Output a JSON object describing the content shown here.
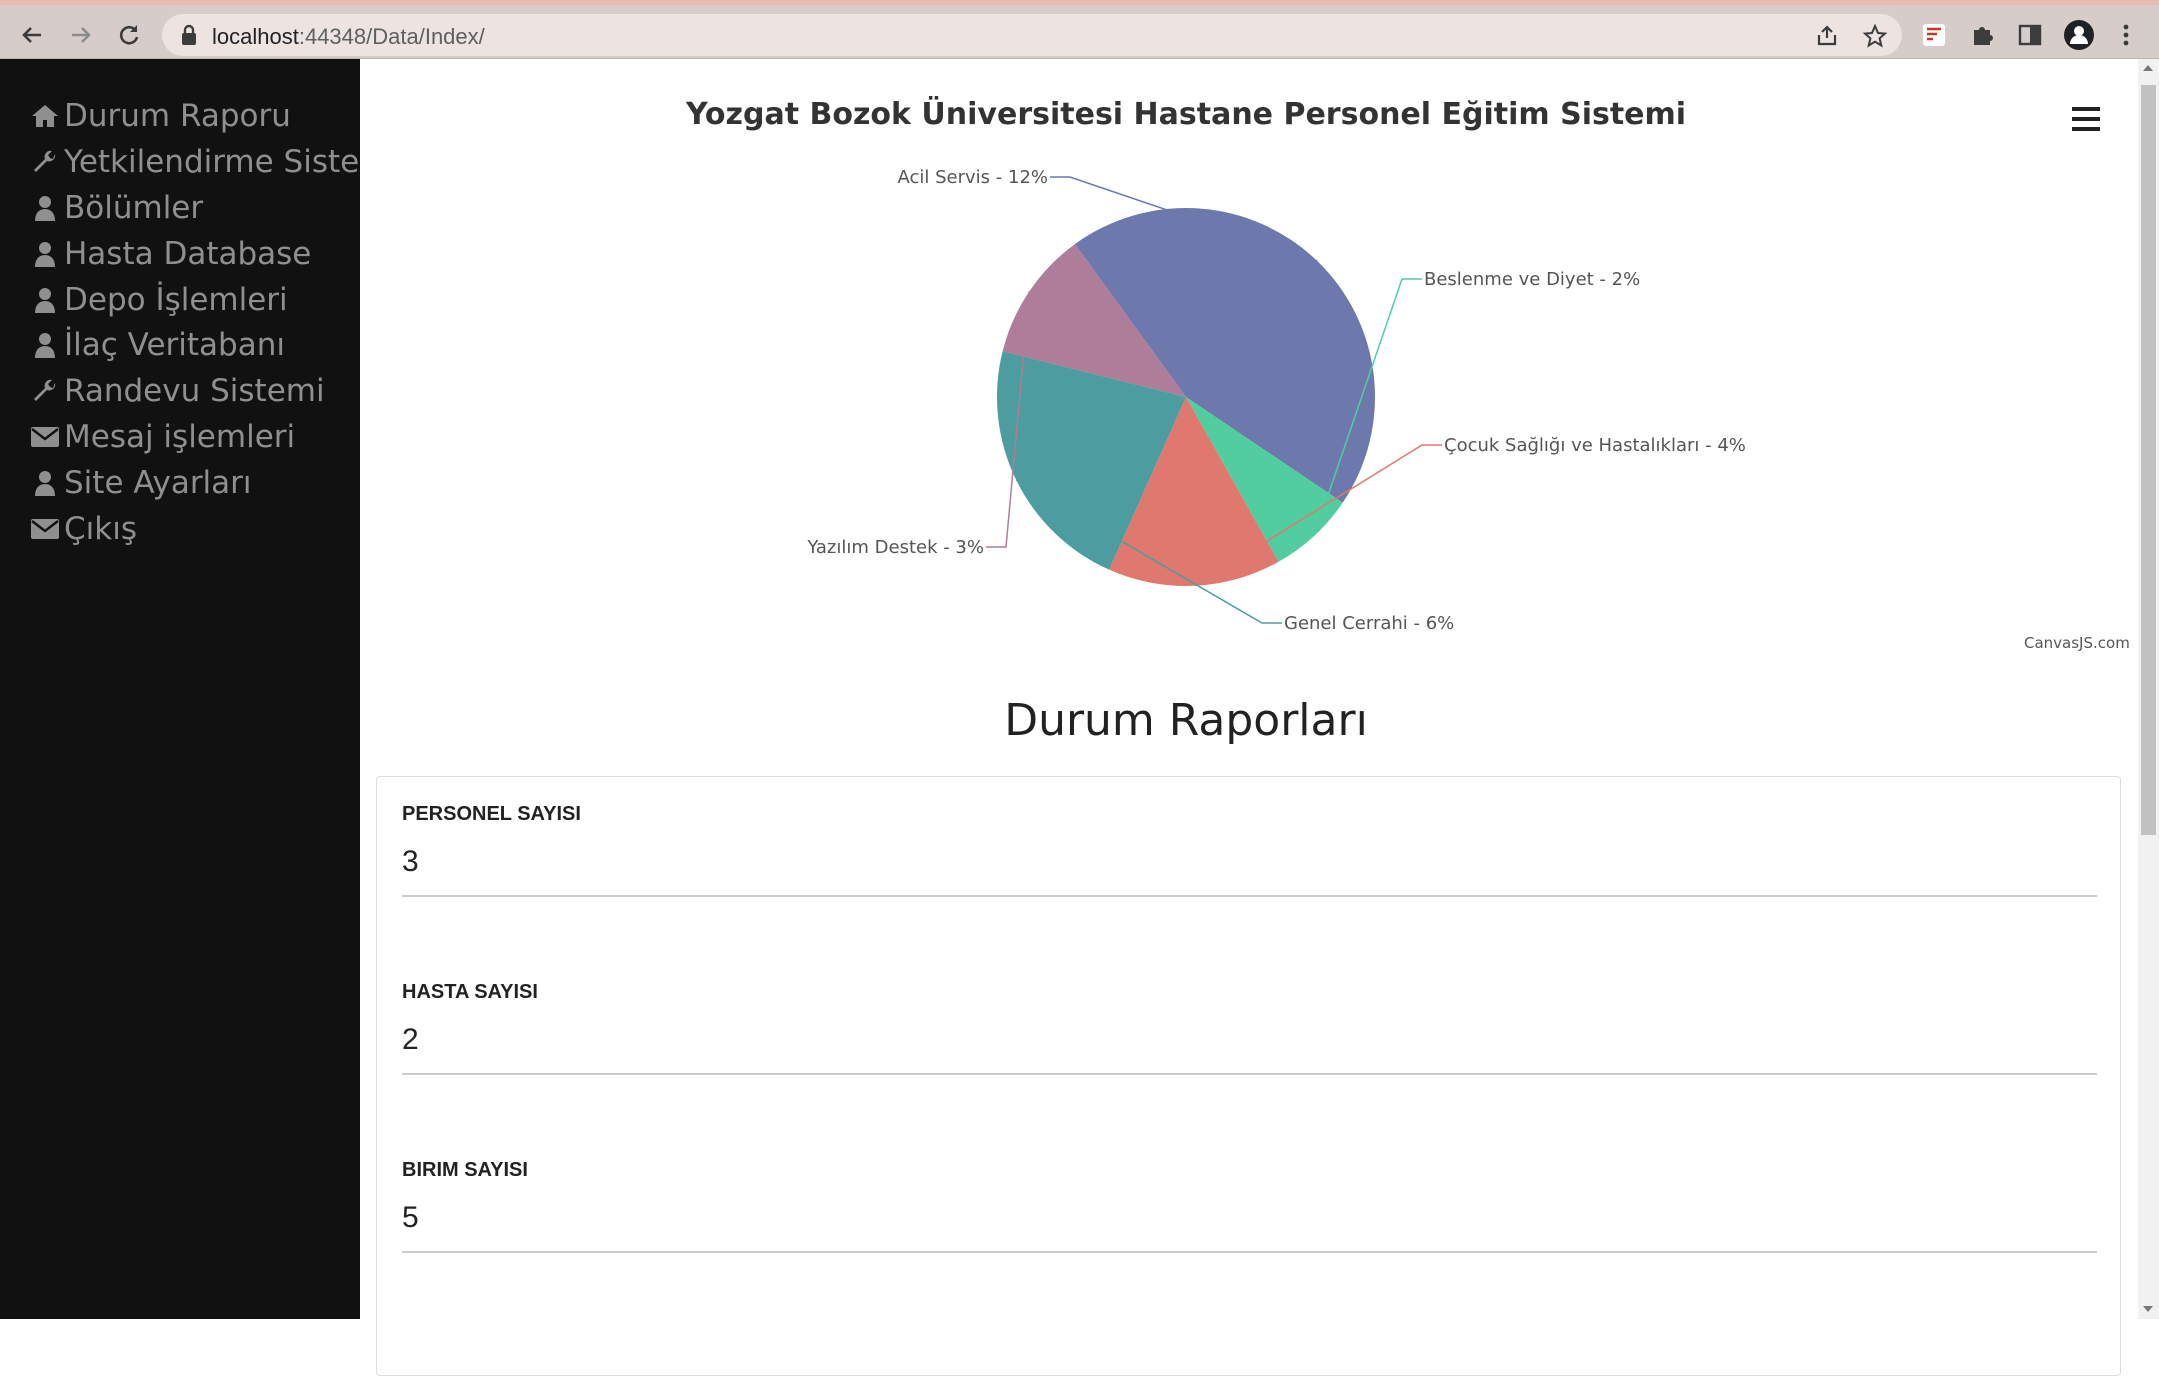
{
  "browser": {
    "url_host": "localhost",
    "url_rest": ":44348/Data/Index/"
  },
  "sidebar": {
    "items": [
      {
        "label": "Durum Raporu",
        "icon": "home-icon"
      },
      {
        "label": "Yetkilendirme Sistemi",
        "icon": "wrench-icon"
      },
      {
        "label": "Bölümler",
        "icon": "user-icon"
      },
      {
        "label": "Hasta Database",
        "icon": "user-icon"
      },
      {
        "label": "Depo İşlemleri",
        "icon": "user-icon"
      },
      {
        "label": "İlaç Veritabanı",
        "icon": "user-icon"
      },
      {
        "label": "Randevu Sistemi",
        "icon": "wrench-icon"
      },
      {
        "label": "Mesaj işlemleri",
        "icon": "envelope-icon"
      },
      {
        "label": "Site Ayarları",
        "icon": "user-icon"
      },
      {
        "label": "Çıkış",
        "icon": "envelope-icon"
      }
    ]
  },
  "chart_data": {
    "type": "pie",
    "title": "Yozgat Bozok Üniversitesi Hastane Personel Eğitim Sistemi",
    "slices": [
      {
        "name": "Acil Servis",
        "value": 12,
        "label": "Acil Servis - 12%",
        "color": "#6d78ad"
      },
      {
        "name": "Beslenme ve Diyet",
        "value": 2,
        "label": "Beslenme ve Diyet - 2%",
        "color": "#51cda0"
      },
      {
        "name": "Çocuk Sağlığı ve Hastalıkları",
        "value": 4,
        "label": "Çocuk Sağlığı ve Hastalıkları - 4%",
        "color": "#df7970"
      },
      {
        "name": "Genel Cerrahi",
        "value": 6,
        "label": "Genel Cerrahi - 6%",
        "color": "#4c9ca0"
      },
      {
        "name": "Yazılım Destek",
        "value": 3,
        "label": "Yazılım Destek - 3%",
        "color": "#ae7d99"
      }
    ],
    "credit": "CanvasJS.com"
  },
  "main": {
    "section_title": "Durum Raporları",
    "stats": [
      {
        "label": "PERSONEL SAYISI",
        "value": "3"
      },
      {
        "label": "HASTA SAYISI",
        "value": "2"
      },
      {
        "label": "BIRIM SAYISI",
        "value": "5"
      }
    ]
  }
}
